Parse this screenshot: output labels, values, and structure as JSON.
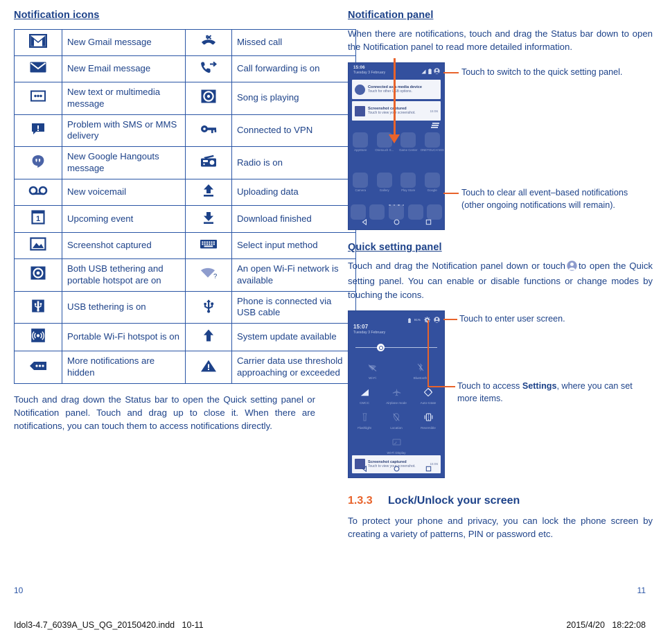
{
  "left": {
    "heading": "Notification icons",
    "table": {
      "rows": [
        {
          "icon_a": "gmail-icon",
          "label_a": "New Gmail message",
          "icon_b": "missed-call-icon",
          "label_b": "Missed call"
        },
        {
          "icon_a": "email-icon",
          "label_a": "New Email message",
          "icon_b": "call-forwarding-icon",
          "label_b": "Call forwarding is on"
        },
        {
          "icon_a": "sms-mms-icon",
          "label_a": "New text or multimedia message",
          "icon_b": "music-playing-icon",
          "label_b": "Song is playing"
        },
        {
          "icon_a": "sms-problem-icon",
          "label_a": "Problem with SMS or MMS delivery",
          "icon_b": "vpn-key-icon",
          "label_b": "Connected to VPN"
        },
        {
          "icon_a": "hangouts-icon",
          "label_a": "New Google Hangouts message",
          "icon_b": "radio-icon",
          "label_b": "Radio is on"
        },
        {
          "icon_a": "voicemail-icon",
          "label_a": "New voicemail",
          "icon_b": "upload-icon",
          "label_b": "Uploading data"
        },
        {
          "icon_a": "calendar-event-icon",
          "label_a": "Upcoming event",
          "icon_b": "download-icon",
          "label_b": "Download finished"
        },
        {
          "icon_a": "screenshot-icon",
          "label_a": "Screenshot captured",
          "icon_b": "keyboard-icon",
          "label_b": "Select input method"
        },
        {
          "icon_a": "usb-tethering-hotspot-icon",
          "label_a": "Both USB tethering and portable hotspot are on",
          "icon_b": "open-wifi-icon",
          "label_b": "An open Wi-Fi network is available"
        },
        {
          "icon_a": "usb-tethering-icon",
          "label_a": "USB tethering is on",
          "icon_b": "usb-cable-icon",
          "label_b": "Phone is connected via USB cable"
        },
        {
          "icon_a": "portable-hotspot-icon",
          "label_a": "Portable Wi-Fi hotspot is on",
          "icon_b": "system-update-icon",
          "label_b": "System update available"
        },
        {
          "icon_a": "more-notifications-icon",
          "label_a": "More notifications are hidden",
          "icon_b": "data-warning-icon",
          "label_b": "Carrier data use threshold approaching or exceeded"
        }
      ]
    },
    "paragraph": "Touch and drag down the Status bar to open the Quick setting panel or Notification panel. Touch and drag up to close it. When there are notifications, you can touch them to access notifications directly."
  },
  "right": {
    "notification_panel": {
      "heading": "Notification panel",
      "paragraph": "When there are notifications, touch and drag the Status bar down to open the Notification panel to read more detailed information.",
      "callout_top": "Touch to switch to the quick setting panel.",
      "callout_bottom": "Touch to clear all event–based notifications (other ongoing notifications will remain).",
      "phone": {
        "time": "15:06",
        "date": "Tuesday 3 February",
        "status_icons": [
          "signal-icon",
          "battery-icon",
          "user-avatar-icon"
        ],
        "notifications": [
          {
            "title": "Connected as a media device",
            "subtitle": "Touch for other USB options.",
            "time": "",
            "icon": "usb-icon"
          },
          {
            "title": "Screenshot captured",
            "subtitle": "Touch to view your screenshot.",
            "time": "15:06",
            "icon": "screenshot-thumb-icon"
          }
        ],
        "apps_row1": [
          {
            "label": "AppStore",
            "icon": "appstore-icon"
          },
          {
            "label": "Onetouch S...",
            "icon": "cart-icon"
          },
          {
            "label": "Game Center",
            "icon": "gamepad-icon"
          },
          {
            "label": "ONETOUCH MIX",
            "icon": "onetouch-mix-icon"
          }
        ],
        "apps_row2": [
          {
            "label": "Camera",
            "icon": "camera-icon"
          },
          {
            "label": "Gallery",
            "icon": "gallery-icon"
          },
          {
            "label": "Play Store",
            "icon": "play-store-icon"
          },
          {
            "label": "Google",
            "icon": "google-folder-icon"
          }
        ],
        "dock": [
          {
            "icon": "phone-icon"
          },
          {
            "icon": "contacts-icon"
          },
          {
            "icon": "app-drawer-icon"
          },
          {
            "icon": "messaging-icon"
          },
          {
            "icon": "browser-icon"
          }
        ],
        "navbar": [
          "back-icon",
          "home-icon",
          "recents-icon"
        ]
      }
    },
    "quick_setting_panel": {
      "heading": "Quick setting panel",
      "paragraph_1": "Touch and drag the Notification panel down or touch",
      "paragraph_2": "to open the Quick setting panel. You can enable or disable functions or change modes by touching the icons.",
      "inline_icon": "user-avatar-icon",
      "callout_top": "Touch to enter user screen.",
      "callout_bottom_pre": "Touch to access ",
      "callout_bottom_bold": "Settings",
      "callout_bottom_post": ", where you can set more items.",
      "phone": {
        "time": "15:07",
        "date": "Tuesday 3 February",
        "status_icons": [
          "battery-icon",
          "battery-percent",
          "gear-icon",
          "user-avatar-icon"
        ],
        "battery_percent": "91%",
        "brightness_slider": 26,
        "tiles_row1": [
          {
            "label": "Wi-Fi",
            "icon": "wifi-off-icon"
          },
          {
            "label": "Bluetooth",
            "icon": "bluetooth-off-icon"
          }
        ],
        "tiles_row2": [
          {
            "label": "CMCC",
            "icon": "mobile-data-icon"
          },
          {
            "label": "Airplane mode",
            "icon": "airplane-icon"
          },
          {
            "label": "Auto-rotate",
            "icon": "auto-rotate-icon"
          }
        ],
        "tiles_row3": [
          {
            "label": "Flashlight",
            "icon": "flashlight-icon"
          },
          {
            "label": "Location",
            "icon": "location-off-icon"
          },
          {
            "label": "Reversible",
            "icon": "reversible-icon"
          }
        ],
        "tiles_row4": [
          {
            "label": "Wi-Fi Display",
            "icon": "cast-icon"
          }
        ],
        "bottom_notification": {
          "title": "Screenshot captured",
          "subtitle": "Touch to view your screenshot.",
          "time": "15:06",
          "icon": "screenshot-thumb-icon"
        },
        "navbar": [
          "back-icon",
          "home-icon",
          "recents-icon"
        ]
      }
    },
    "section": {
      "number": "1.3.3",
      "title": "Lock/Unlock your screen",
      "paragraph": "To protect your phone and privacy, you can lock the phone screen by creating a variety of patterns, PIN or password etc."
    }
  },
  "footer": {
    "page_left": "10",
    "page_right": "11",
    "print_left": "Idol3-4.7_6039A_US_QG_20150420.indd   10-11",
    "print_right": "2015/4/20   18:22:08"
  },
  "colors": {
    "blue": "#1d4289",
    "table_border": "#2a55a5",
    "orange": "#e8632b",
    "phone_bg": "#33509e"
  }
}
